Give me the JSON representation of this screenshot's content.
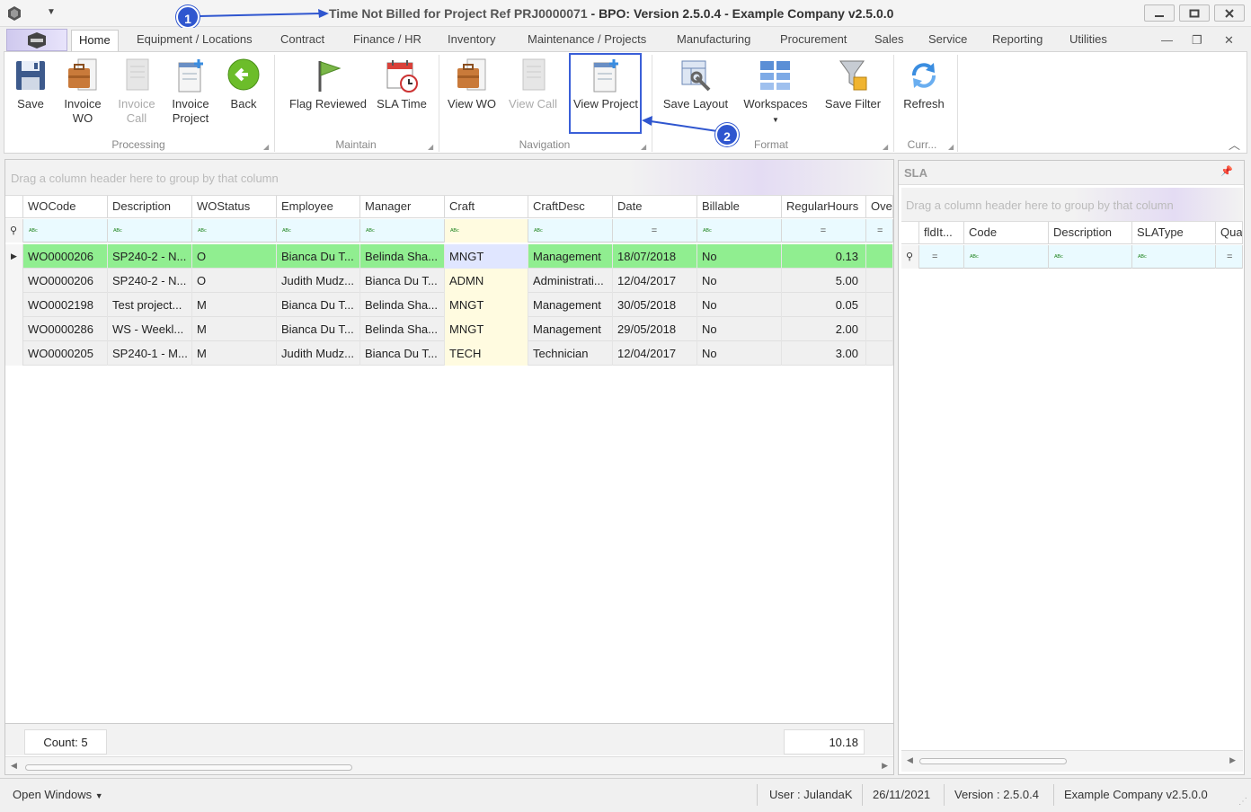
{
  "window": {
    "title": "Time Not Billed for Project Ref PRJ0000071",
    "title_rest": " - BPO: Version 2.5.0.4 - Example Company v2.5.0.0"
  },
  "tabs": [
    "Home",
    "Equipment / Locations",
    "Contract",
    "Finance / HR",
    "Inventory",
    "Maintenance / Projects",
    "Manufacturing",
    "Procurement",
    "Sales",
    "Service",
    "Reporting",
    "Utilities"
  ],
  "ribbon": {
    "groups": {
      "processing": "Processing",
      "maintain": "Maintain",
      "navigation": "Navigation",
      "format": "Format",
      "curr": "Curr..."
    },
    "buttons": {
      "save": "Save",
      "invoice_wo": [
        "Invoice",
        "WO"
      ],
      "invoice_call": [
        "Invoice",
        "Call"
      ],
      "invoice_project": [
        "Invoice",
        "Project"
      ],
      "back": "Back",
      "flag_reviewed": "Flag Reviewed",
      "sla_time": "SLA Time",
      "view_wo": "View WO",
      "view_call": "View Call",
      "view_project": "View Project",
      "save_layout": "Save Layout",
      "workspaces": "Workspaces",
      "save_filter": "Save Filter",
      "refresh": "Refresh"
    }
  },
  "callouts": [
    "1",
    "2"
  ],
  "grid": {
    "group_hint": "Drag a column header here to group by that column",
    "columns": [
      "WOCode",
      "Description",
      "WOStatus",
      "Employee",
      "Manager",
      "Craft",
      "CraftDesc",
      "Date",
      "Billable",
      "RegularHours",
      "Over"
    ],
    "rows": [
      [
        "WO0000206",
        "SP240-2 - N...",
        "O",
        "Bianca Du T...",
        "Belinda Sha...",
        "MNGT",
        "Management",
        "18/07/2018",
        "No",
        "0.13"
      ],
      [
        "WO0000206",
        "SP240-2 - N...",
        "O",
        "Judith Mudz...",
        "Bianca Du T...",
        "ADMN",
        "Administrati...",
        "12/04/2017",
        "No",
        "5.00"
      ],
      [
        "WO0002198",
        "Test project...",
        "M",
        "Bianca Du T...",
        "Belinda Sha...",
        "MNGT",
        "Management",
        "30/05/2018",
        "No",
        "0.05"
      ],
      [
        "WO0000286",
        "WS - Weekl...",
        "M",
        "Bianca Du T...",
        "Belinda Sha...",
        "MNGT",
        "Management",
        "29/05/2018",
        "No",
        "2.00"
      ],
      [
        "WO0000205",
        "SP240-1 - M...",
        "M",
        "Judith Mudz...",
        "Bianca Du T...",
        "TECH",
        "Technician",
        "12/04/2017",
        "No",
        "3.00"
      ]
    ],
    "footer": {
      "count": "Count: 5",
      "total_hours": "10.18"
    }
  },
  "sla_panel": {
    "title": "SLA",
    "group_hint": "Drag a column header here to group by that column",
    "columns": [
      "fldIt...",
      "Code",
      "Description",
      "SLAType",
      "Qua"
    ]
  },
  "statusbar": {
    "open_windows": "Open Windows",
    "user": "User : JulandaK",
    "date": "26/11/2021",
    "version": "Version : 2.5.0.4",
    "company": "Example Company v2.5.0.0"
  },
  "colors": {
    "selected_row": "#90ee90",
    "callout": "#2f56cf",
    "filter_row": "#eafaff"
  }
}
